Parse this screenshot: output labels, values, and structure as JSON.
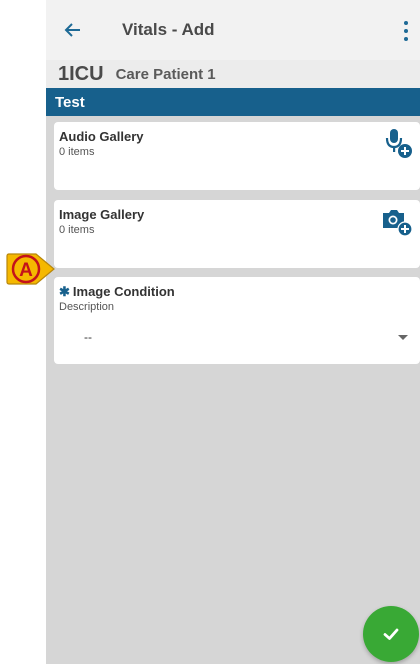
{
  "appbar": {
    "title": "Vitals - Add",
    "back_icon": "arrow-left-icon",
    "more_icon": "more-vert-icon"
  },
  "patient": {
    "bed": "1ICU",
    "name": "Care Patient 1"
  },
  "section": {
    "title": "Test"
  },
  "audio_gallery": {
    "title": "Audio Gallery",
    "count": "0 items",
    "icon": "mic-add-icon"
  },
  "image_gallery": {
    "title": "Image Gallery",
    "count": "0 items",
    "icon": "camera-add-icon"
  },
  "image_condition": {
    "required_mark": "✱",
    "title": "Image Condition",
    "label": "Description",
    "value": "--"
  },
  "fab": {
    "icon": "check-icon"
  },
  "marker": {
    "label": "A"
  },
  "colors": {
    "primary": "#17608c",
    "fab": "#39a935",
    "marker": "#f5b800",
    "marker_text": "#c4121a"
  }
}
